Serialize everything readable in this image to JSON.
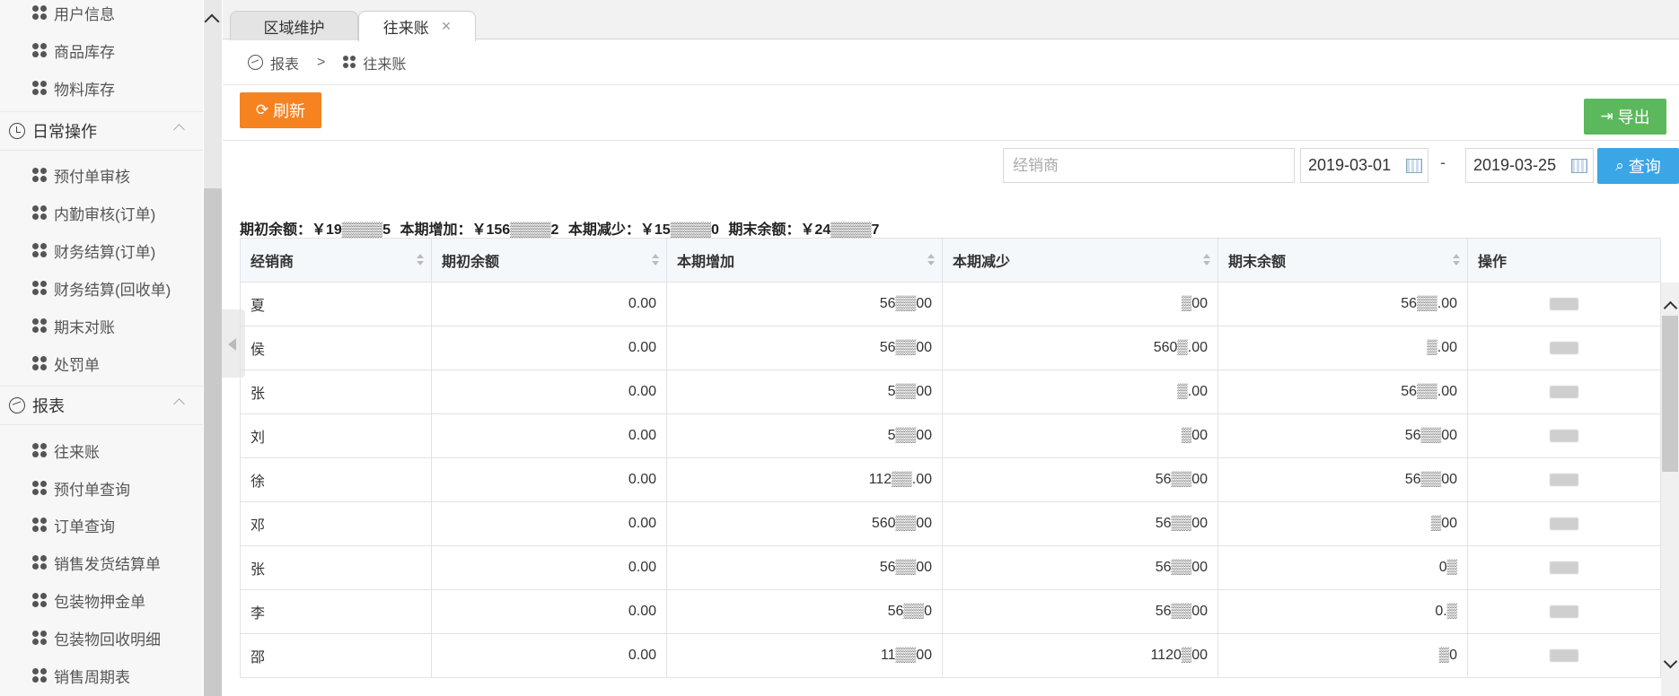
{
  "sidebar": {
    "items_top": [
      "用户信息",
      "商品库存",
      "物料库存"
    ],
    "group_daily": "日常操作",
    "items_daily": [
      "预付单审核",
      "内勤审核(订单)",
      "财务结算(订单)",
      "财务结算(回收单)",
      "期末对账",
      "处罚单"
    ],
    "group_report": "报表",
    "items_report": [
      "往来账",
      "预付单查询",
      "订单查询",
      "销售发货结算单",
      "包装物押金单",
      "包装物回收明细",
      "销售周期表"
    ]
  },
  "tabs": [
    {
      "label": "区域维护"
    },
    {
      "label": "往来账",
      "close": "×"
    }
  ],
  "breadcrumb": {
    "root": "报表",
    "sep": ">",
    "current": "往来账"
  },
  "toolbar": {
    "refresh_label": "刷新",
    "export_label": "导出"
  },
  "filters": {
    "dealer_placeholder": "经销商",
    "date_start": "2019-03-01",
    "date_sep": "-",
    "date_end": "2019-03-25",
    "search_label": "查询"
  },
  "summary": {
    "opening": "期初余额：￥19▒▒▒▒5",
    "increase": "本期增加：￥156▒▒▒▒2",
    "decrease": "本期减少：￥15▒▒▒▒0",
    "closing": "期末余额：￥24▒▒▒▒7"
  },
  "table": {
    "columns": [
      "经销商",
      "期初余额",
      "本期增加",
      "本期减少",
      "期末余额",
      "操作"
    ],
    "rows": [
      {
        "dealer": "夏",
        "opening": "0.00",
        "increase": "56▒▒00",
        "decrease": "▒00",
        "closing": "56▒▒.00"
      },
      {
        "dealer": "侯",
        "opening": "0.00",
        "increase": "56▒▒00",
        "decrease": "560▒.00",
        "closing": "▒.00"
      },
      {
        "dealer": "张",
        "opening": "0.00",
        "increase": "5▒▒00",
        "decrease": "▒.00",
        "closing": "56▒▒.00"
      },
      {
        "dealer": "刘",
        "opening": "0.00",
        "increase": "5▒▒00",
        "decrease": "▒00",
        "closing": "56▒▒00"
      },
      {
        "dealer": "徐",
        "opening": "0.00",
        "increase": "112▒▒.00",
        "decrease": "56▒▒00",
        "closing": "56▒▒00"
      },
      {
        "dealer": "邓",
        "opening": "0.00",
        "increase": "560▒▒00",
        "decrease": "56▒▒00",
        "closing": "▒00"
      },
      {
        "dealer": "张",
        "opening": "0.00",
        "increase": "56▒▒00",
        "decrease": "56▒▒00",
        "closing": "0▒"
      },
      {
        "dealer": "李",
        "opening": "0.00",
        "increase": "56▒▒0",
        "decrease": "56▒▒00",
        "closing": "0.▒"
      },
      {
        "dealer": "邵",
        "opening": "0.00",
        "increase": "11▒▒00",
        "decrease": "1120▒00",
        "closing": "▒0"
      }
    ]
  }
}
